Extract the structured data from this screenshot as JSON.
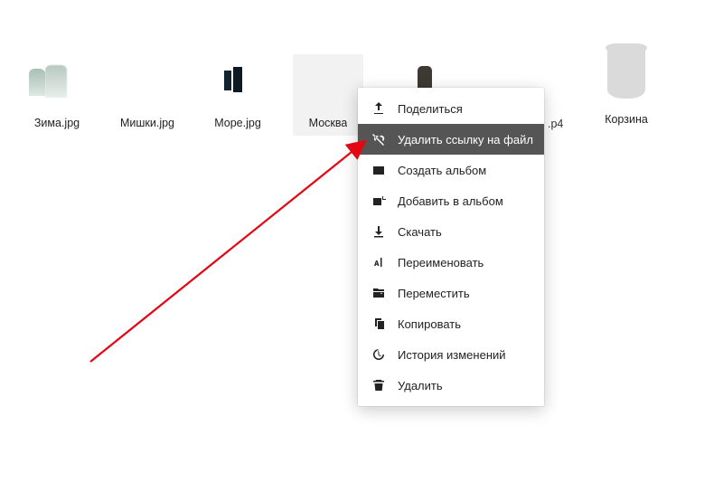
{
  "files": [
    {
      "label": "Зима.jpg",
      "selected": false
    },
    {
      "label": "Мишки.jpg",
      "selected": false
    },
    {
      "label": "Море.jpg",
      "selected": false
    },
    {
      "label": "Москва",
      "selected": true
    },
    {
      "label": "",
      "selected": false
    },
    {
      "label": ".p4",
      "selected": false
    }
  ],
  "trash": {
    "label": "Корзина"
  },
  "context_menu": {
    "items": [
      {
        "label": "Поделиться",
        "icon": "share",
        "highlight": false
      },
      {
        "label": "Удалить ссылку на файл",
        "icon": "unlink",
        "highlight": true
      },
      {
        "label": "Создать альбом",
        "icon": "album-create",
        "highlight": false
      },
      {
        "label": "Добавить в альбом",
        "icon": "album-add",
        "highlight": false
      },
      {
        "label": "Скачать",
        "icon": "download",
        "highlight": false
      },
      {
        "label": "Переименовать",
        "icon": "rename",
        "highlight": false
      },
      {
        "label": "Переместить",
        "icon": "move",
        "highlight": false
      },
      {
        "label": "Копировать",
        "icon": "copy",
        "highlight": false
      },
      {
        "label": "История изменений",
        "icon": "history",
        "highlight": false
      },
      {
        "label": "Удалить",
        "icon": "delete",
        "highlight": false
      }
    ]
  },
  "arrow": {
    "color": "#E30613"
  }
}
